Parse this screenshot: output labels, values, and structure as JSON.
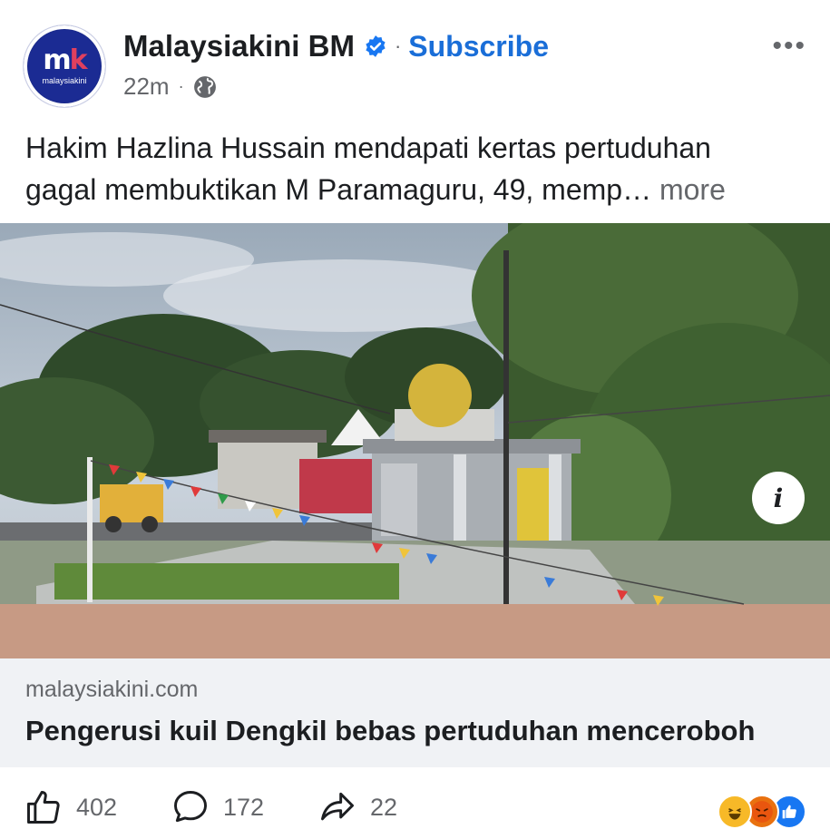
{
  "post": {
    "page_name": "Malaysiakini BM",
    "subscribe_label": "Subscribe",
    "separator": "·",
    "timestamp": "22m",
    "meta_separator": "·",
    "audience_icon": "globe-icon",
    "logo": {
      "mark_m": "m",
      "mark_k": "k",
      "text": "malaysiakini"
    },
    "caption_line1": "Hakim Hazlina Hussain mendapati kertas pertuduhan",
    "caption_line2": "gagal membuktikan M Paramaguru, 49, memp…",
    "caption_more": "more"
  },
  "photo": {
    "info_label": "i"
  },
  "link_preview": {
    "domain": "malaysiakini.com",
    "headline": "Pengerusi kuil Dengkil bebas pertuduhan menceroboh"
  },
  "actions": {
    "like_count": "402",
    "comment_count": "172",
    "share_count": "22"
  },
  "colors": {
    "accent": "#1a6ed8",
    "verified": "#1877f2",
    "brand_navy": "#1b2b93",
    "brand_pink": "#e0405e"
  }
}
